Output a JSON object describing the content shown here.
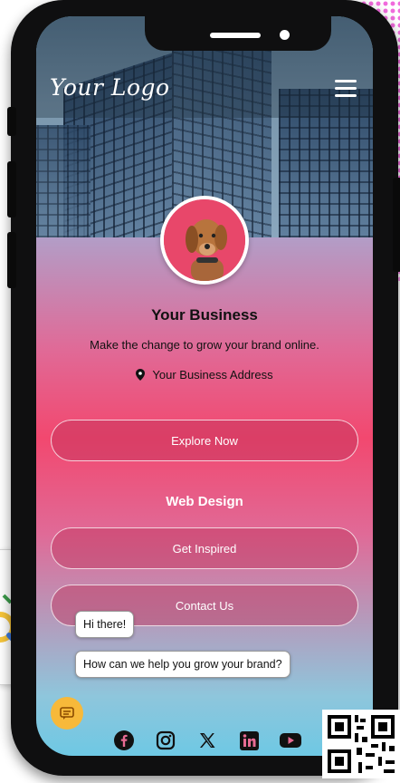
{
  "brand": {
    "logo_text": "Your Logo"
  },
  "profile": {
    "business_name": "Your Business",
    "tagline": "Make the change to grow your brand online.",
    "address": "Your Business Address"
  },
  "actions": {
    "explore": "Explore Now",
    "section_title": "Web Design",
    "inspired": "Get Inspired",
    "contact": "Contact Us"
  },
  "chat": {
    "greeting": "Hi there!",
    "prompt": "How can we help you grow your brand?"
  },
  "social": [
    "facebook-icon",
    "instagram-icon",
    "x-icon",
    "linkedin-icon",
    "youtube-icon"
  ],
  "colors": {
    "accent": "#f2486f",
    "chat_button": "#f7b93a"
  }
}
